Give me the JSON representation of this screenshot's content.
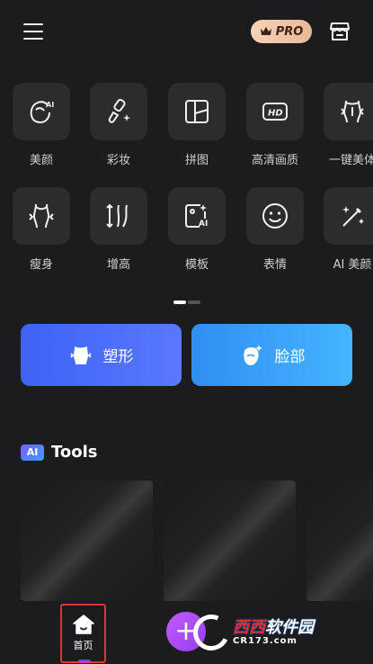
{
  "header": {
    "pro_label": "PRO",
    "menu_icon": "hamburger-menu-icon",
    "store_icon": "store-icon"
  },
  "tools": [
    {
      "label": "美颜",
      "icon": "ai-face-icon"
    },
    {
      "label": "彩妆",
      "icon": "makeup-brush-icon"
    },
    {
      "label": "拼图",
      "icon": "collage-icon"
    },
    {
      "label": "高清画质",
      "icon": "hd-icon"
    },
    {
      "label": "一键美体",
      "icon": "body-shape-icon"
    },
    {
      "label": "瘦身",
      "icon": "slim-icon"
    },
    {
      "label": "增高",
      "icon": "height-icon"
    },
    {
      "label": "模板",
      "icon": "ai-template-icon"
    },
    {
      "label": "表情",
      "icon": "smiley-icon"
    },
    {
      "label": "AI 美颜",
      "icon": "magic-wand-icon"
    }
  ],
  "pager": {
    "pages": 2,
    "current": 1
  },
  "feature_buttons": [
    {
      "label": "塑形",
      "icon": "body-reshape-icon",
      "color": "#4a6cf7"
    },
    {
      "label": "脸部",
      "icon": "face-icon",
      "color": "#3aa6f8"
    }
  ],
  "ai_tools": {
    "badge": "AI",
    "title": "Tools",
    "card_count": 3
  },
  "bottom_nav": {
    "home_label": "首页",
    "add_symbol": "+",
    "accent_color": "#b04cff"
  },
  "watermark": {
    "brand_part1": "西西",
    "brand_part2": "软件园",
    "url": "CR173.com"
  }
}
